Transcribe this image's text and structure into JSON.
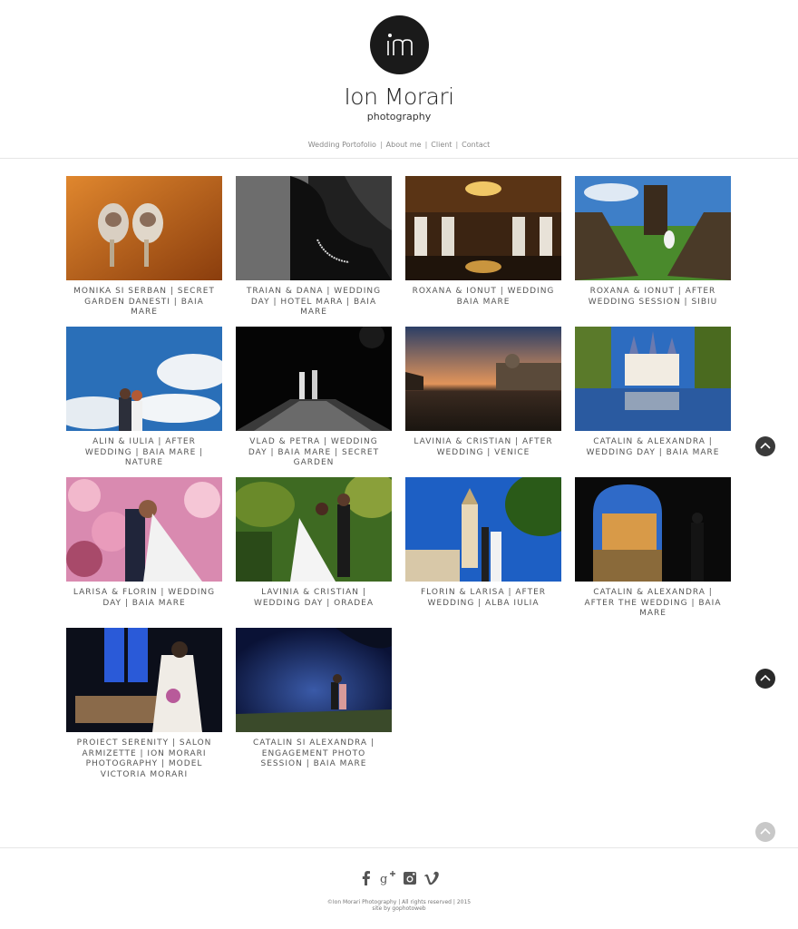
{
  "brand": {
    "monogram": "im",
    "name": "Ion Morari",
    "tagline": "photography"
  },
  "nav": {
    "items": [
      {
        "label": "Wedding Portofolio"
      },
      {
        "label": "About me"
      },
      {
        "label": "Client"
      },
      {
        "label": "Contact"
      }
    ],
    "separator": "|"
  },
  "gallery": {
    "items": [
      {
        "caption": "MONIKA SI SERBAN | SECRET GARDEN DANESTI | BAIA MARE",
        "scene": "shoes"
      },
      {
        "caption": "TRAIAN & DANA | WEDDING DAY | HOTEL MARA | BAIA MARE",
        "scene": "bw-portrait"
      },
      {
        "caption": "ROXANA & IONUT | WEDDING BAIA MARE",
        "scene": "hall"
      },
      {
        "caption": "ROXANA & IONUT | AFTER WEDDING SESSION | SIBIU",
        "scene": "field"
      },
      {
        "caption": "ALIN & IULIA | AFTER WEDDING | BAIA MARE | NATURE",
        "scene": "sky-couple"
      },
      {
        "caption": "VLAD & PETRA | WEDDING DAY | BAIA MARE | SECRET GARDEN",
        "scene": "night-bw"
      },
      {
        "caption": "LAVINIA & CRISTIAN | AFTER WEDDING | VENICE",
        "scene": "venice"
      },
      {
        "caption": "CATALIN & ALEXANDRA | WEDDING DAY | BAIA MARE",
        "scene": "castle"
      },
      {
        "caption": "LARISA & FLORIN | WEDDING DAY | BAIA MARE",
        "scene": "blossom"
      },
      {
        "caption": "LAVINIA & CRISTIAN | WEDDING DAY | ORADEA",
        "scene": "garden"
      },
      {
        "caption": "FLORIN & LARISA | AFTER WEDDING | ALBA IULIA",
        "scene": "cathedral"
      },
      {
        "caption": "CATALIN & ALEXANDRA | AFTER THE WEDDING | BAIA MARE",
        "scene": "arch"
      },
      {
        "caption": "PROIECT SERENITY | SALON ARMIZETTE | ION MORARI PHOTOGRAPHY | MODEL VICTORIA MORARI",
        "scene": "window-bride"
      },
      {
        "caption": "CATALIN SI ALEXANDRA | ENGAGEMENT PHOTO SESSION | BAIA MARE",
        "scene": "night-couple"
      }
    ]
  },
  "footer": {
    "social": [
      "facebook-icon",
      "google-plus-icon",
      "instagram-icon",
      "vimeo-icon"
    ],
    "copyright": "©Ion Morari Photography | All rights reserved | 2015",
    "credit": "site by gophotoweb"
  },
  "colors": {
    "logo": "#1a1a1a",
    "nav_text": "#888888",
    "caption_text": "#555555",
    "to_top_dark": "#3a3a3a",
    "to_top_light": "#c8c8c8"
  }
}
